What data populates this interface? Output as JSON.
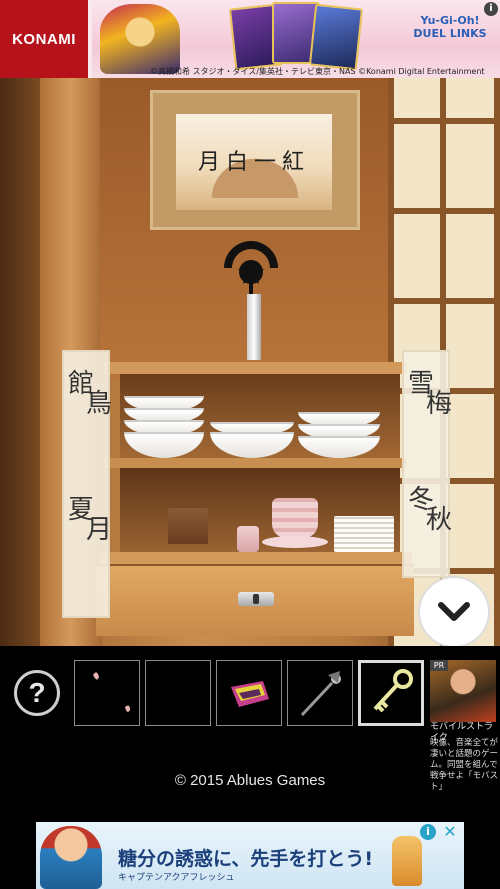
{
  "top_ad": {
    "brand": "KONAMI",
    "product_logo": "Yu-Gi-Oh! DUEL LINKS",
    "copyright": "©高橋和希 スタジオ・ダイス/集英社・テレビ東京・NAS ©Konami Digital Entertainment",
    "info_icon": "i"
  },
  "scene": {
    "scroll_text": "月白一紅",
    "door_left_glyphs": [
      "館",
      "鳥",
      "夏",
      "月"
    ],
    "door_right_glyphs": [
      "雪",
      "梅",
      "冬",
      "秋"
    ]
  },
  "controls": {
    "scroll_down_icon": "chevron-down-icon",
    "help_label": "?"
  },
  "inventory": {
    "slots": [
      {
        "item": "flower-petals"
      },
      {
        "item": "empty"
      },
      {
        "item": "colored-cloth"
      },
      {
        "item": "pointer-tool"
      },
      {
        "item": "key",
        "selected": true
      }
    ]
  },
  "pr_ad": {
    "badge": "PR",
    "title": "モバイルストライク",
    "description": "映像、音楽全てが凄いと話題のゲーム。同盟を組んで戦争せよ「モバスト」"
  },
  "footer": {
    "copyright": "© 2015 Ablues Games"
  },
  "bottom_ad": {
    "headline": "糖分の誘惑に、先手を打とう!",
    "subline": "キャプテンアクアフレッシュ",
    "info_icon": "i",
    "close_icon": "✕"
  },
  "colors": {
    "top_ad_brand": "#b5121b",
    "inventory_bg": "#000000",
    "bottom_ad_text": "#1b3f7a"
  }
}
